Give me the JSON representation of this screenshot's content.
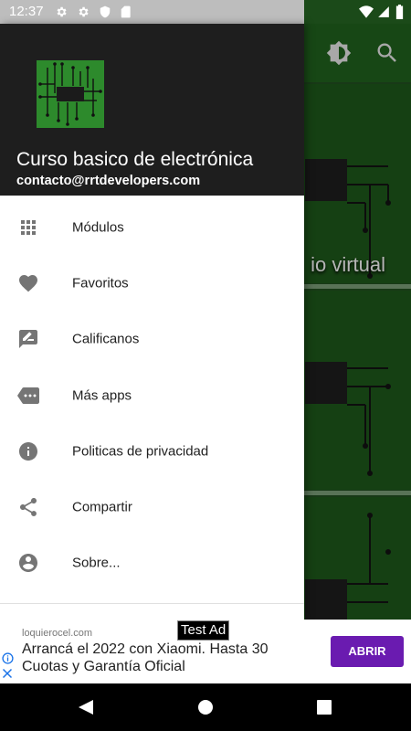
{
  "status_bar": {
    "time": "12:37",
    "left_icons": [
      "gear-icon",
      "gear-icon",
      "shield-icon",
      "sd-card-icon"
    ],
    "right_icons": [
      "wifi-icon",
      "signal-icon",
      "battery-icon"
    ]
  },
  "background_app": {
    "card_title_visible": "io virtual",
    "colors": {
      "primary": "#1e5b1c",
      "card": "#1c5219"
    }
  },
  "drawer": {
    "title": "Curso basico de electrónica",
    "email": "contacto@rrtdevelopers.com",
    "items": [
      {
        "label": "Módulos",
        "icon": "grid-icon"
      },
      {
        "label": "Favoritos",
        "icon": "heart-icon"
      },
      {
        "label": "Calificanos",
        "icon": "rate-review-icon"
      },
      {
        "label": "Más apps",
        "icon": "more-apps-tag-icon"
      },
      {
        "label": "Politicas de privacidad",
        "icon": "info-icon"
      },
      {
        "label": "Compartir",
        "icon": "share-icon"
      },
      {
        "label": "Sobre...",
        "icon": "account-circle-icon"
      }
    ]
  },
  "ad": {
    "badge": "Test Ad",
    "domain": "loquierocel.com",
    "headline": "Arrancá el 2022 con Xiaomi. Hasta 30 Cuotas y Garantía Oficial",
    "cta": "ABRIR",
    "cta_color": "#6a1bb0"
  },
  "nav": {
    "buttons": [
      "back-icon",
      "home-icon",
      "recents-icon"
    ]
  }
}
